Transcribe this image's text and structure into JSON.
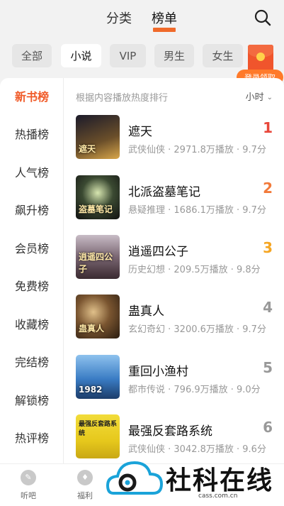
{
  "header": {
    "tabs": [
      {
        "label": "分类"
      },
      {
        "label": "榜单"
      }
    ]
  },
  "chips": [
    {
      "label": "全部"
    },
    {
      "label": "小说"
    },
    {
      "label": "VIP"
    },
    {
      "label": "男生"
    },
    {
      "label": "女生"
    }
  ],
  "promo": {
    "login_label": "登录领取"
  },
  "sidebar": {
    "items": [
      {
        "label": "新书榜"
      },
      {
        "label": "热播榜"
      },
      {
        "label": "人气榜"
      },
      {
        "label": "飙升榜"
      },
      {
        "label": "会员榜"
      },
      {
        "label": "免费榜"
      },
      {
        "label": "收藏榜"
      },
      {
        "label": "完结榜"
      },
      {
        "label": "解锁榜"
      },
      {
        "label": "热评榜"
      }
    ]
  },
  "list": {
    "header": "根据内容播放热度排行",
    "sort_label": "小时",
    "books": [
      {
        "title": "遮天",
        "meta": "武侠仙侠 · 2971.8万播放 · 9.7分",
        "rank": "1",
        "rank_color": "#e8473a",
        "cover_text": "遮天",
        "cover_bg": "#2a2418"
      },
      {
        "title": "北派盗墓笔记",
        "meta": "悬疑推理 · 1686.1万播放 · 9.7分",
        "rank": "2",
        "rank_color": "#f27a3a",
        "cover_text": "盗墓笔记",
        "cover_bg": "#1d2a1e"
      },
      {
        "title": "逍遥四公子",
        "meta": "历史幻想 · 209.5万播放 · 9.8分",
        "rank": "3",
        "rank_color": "#f5a623",
        "cover_text": "逍遥四公子",
        "cover_bg": "#5a4d56"
      },
      {
        "title": "蛊真人",
        "meta": "玄幻奇幻 · 3200.6万播放 · 9.7分",
        "rank": "4",
        "rank_color": "#999999",
        "cover_text": "蛊真人",
        "cover_bg": "#3a2a1a"
      },
      {
        "title": "重回小渔村",
        "meta": "都市传说 · 796.9万播放 · 9.0分",
        "rank": "5",
        "rank_color": "#999999",
        "cover_text": "1982",
        "cover_bg": "#3a7cc4"
      },
      {
        "title": "最强反套路系统",
        "meta": "武侠仙侠 · 3042.8万播放 · 9.6分",
        "rank": "6",
        "rank_color": "#999999",
        "cover_text": "最强反套路系统",
        "cover_bg": "#e6c81c"
      }
    ]
  },
  "bottom_nav": [
    {
      "label": "听吧",
      "icon": "compass-icon"
    },
    {
      "label": "福利",
      "icon": "gift-icon"
    }
  ],
  "watermark": {
    "text": "社科在线",
    "url": "cass.com.cn"
  }
}
